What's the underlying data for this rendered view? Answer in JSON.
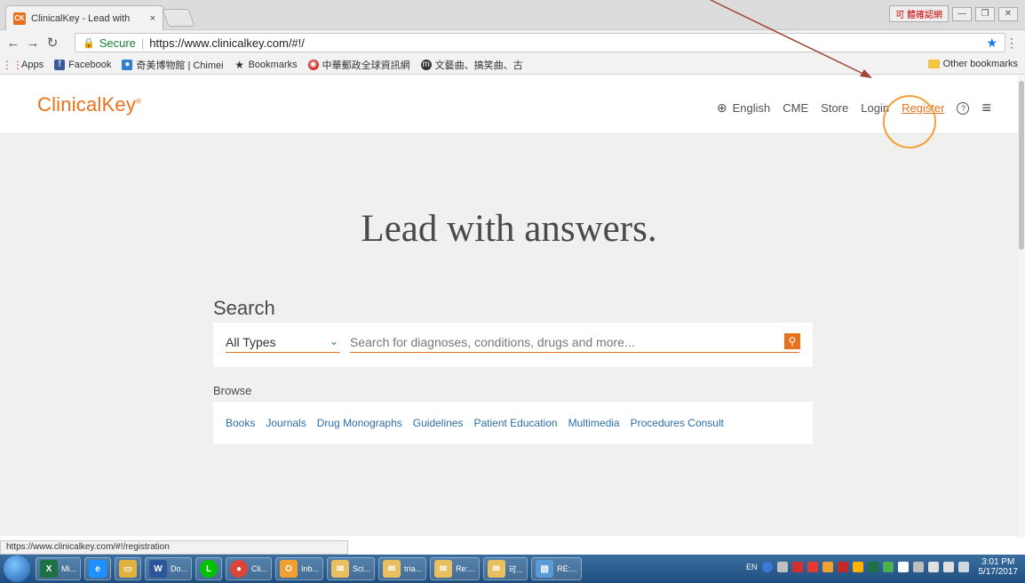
{
  "browser": {
    "tab_title": "ClinicalKey - Lead with",
    "tab_favicon": "CK",
    "tab_close": "×",
    "ime_text": "可 體確認網",
    "url_secure_label": "Secure",
    "url": "https://www.clinicalkey.com/#!/",
    "bookmarks": [
      {
        "label": "Apps",
        "icon": "apps-grid",
        "color": "#e0483e"
      },
      {
        "label": "Facebook",
        "icon": "facebook",
        "color": "#3b5998"
      },
      {
        "label": "奇美博物館 | Chimei",
        "icon": "person-logo",
        "color": "#2f7fd1"
      },
      {
        "label": "Bookmarks",
        "icon": "star",
        "color": "#333333"
      },
      {
        "label": "中華郵政全球資訊網",
        "icon": "post-logo",
        "color": "#d32f2f"
      },
      {
        "label": "文藝曲、搞笑曲、古",
        "icon": "m-logo",
        "color": "#333333"
      }
    ],
    "other_bookmarks": "Other bookmarks",
    "status_url": "https://www.clinicalkey.com/#!/registration"
  },
  "site": {
    "logo": "ClinicalKey",
    "logo_mark": "®",
    "nav": {
      "language": "English",
      "cme": "CME",
      "store": "Store",
      "login": "Login",
      "register": "Register",
      "help": "?"
    },
    "hero_title": "Lead with answers.",
    "search": {
      "label": "Search",
      "type_selected": "All Types",
      "placeholder": "Search for diagnoses, conditions, drugs and more..."
    },
    "browse": {
      "label": "Browse",
      "links": [
        "Books",
        "Journals",
        "Drug Monographs",
        "Guidelines",
        "Patient Education",
        "Multimedia",
        "Procedures Consult"
      ]
    },
    "accent_color": "#e9711c"
  },
  "taskbar": {
    "items": [
      {
        "label": "Mi...",
        "icon": "excel-icon",
        "color": "#1e7145"
      },
      {
        "label": "",
        "icon": "ie-icon",
        "color": "#1e90ff"
      },
      {
        "label": "",
        "icon": "folder-icon",
        "color": "#e0b040"
      },
      {
        "label": "Do...",
        "icon": "word-icon",
        "color": "#2b579a"
      },
      {
        "label": "",
        "icon": "line-icon",
        "color": "#00c300"
      },
      {
        "label": "Cli...",
        "icon": "chrome-icon",
        "color": "#db4437"
      },
      {
        "label": "Inb...",
        "icon": "outlook-icon",
        "color": "#f0a030"
      },
      {
        "label": "Sci...",
        "icon": "mail-icon",
        "color": "#e8c060"
      },
      {
        "label": "tria...",
        "icon": "mail-icon",
        "color": "#e8c060"
      },
      {
        "label": "Re:...",
        "icon": "mail-icon",
        "color": "#e8c060"
      },
      {
        "label": "可...",
        "icon": "mail-icon",
        "color": "#e8c060"
      },
      {
        "label": "RE:...",
        "icon": "doc-icon",
        "color": "#5b9bd5"
      }
    ],
    "tray_lang": "EN",
    "time": "3:01 PM",
    "date": "5/17/2017"
  }
}
